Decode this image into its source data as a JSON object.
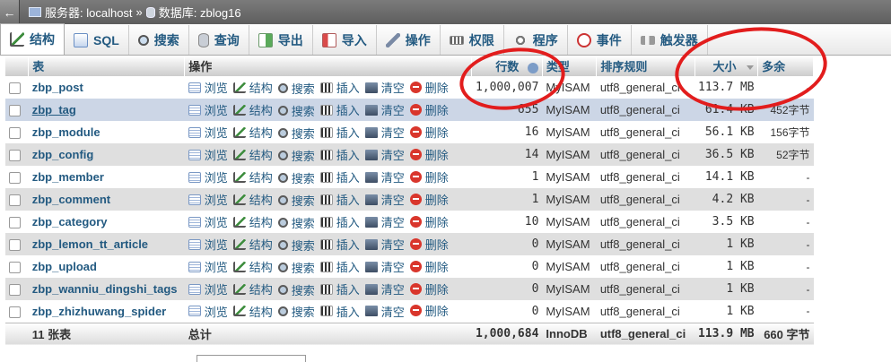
{
  "topbar": {
    "back_glyph": "←",
    "server_label": "服务器: localhost",
    "separator": "»",
    "database_label": "数据库: zblog16"
  },
  "tabs": [
    {
      "label": "结构",
      "icon": "structure-icon",
      "active": true
    },
    {
      "label": "SQL",
      "icon": "sql-icon"
    },
    {
      "label": "搜索",
      "icon": "search-icon"
    },
    {
      "label": "查询",
      "icon": "query-icon"
    },
    {
      "label": "导出",
      "icon": "export-icon"
    },
    {
      "label": "导入",
      "icon": "import-icon"
    },
    {
      "label": "操作",
      "icon": "wrench-icon"
    },
    {
      "label": "权限",
      "icon": "privileges-icon"
    },
    {
      "label": "程序",
      "icon": "routines-icon"
    },
    {
      "label": "事件",
      "icon": "clock-icon"
    },
    {
      "label": "触发器",
      "icon": "triggers-icon"
    }
  ],
  "table": {
    "headers": {
      "table": "表",
      "action": "操作",
      "rows": "行数",
      "type": "类型",
      "collation": "排序规则",
      "size": "大小",
      "overhead": "多余"
    },
    "actions": {
      "browse": "浏览",
      "structure": "结构",
      "search": "搜索",
      "insert": "插入",
      "empty": "清空",
      "drop": "删除"
    },
    "rows": [
      {
        "name": "zbp_post",
        "rows": "1,000,007",
        "type": "MyISAM",
        "collation": "utf8_general_ci",
        "size": "113.7 MB",
        "overhead": "-"
      },
      {
        "name": "zbp_tag",
        "rows": "655",
        "type": "MyISAM",
        "collation": "utf8_general_ci",
        "size": "61.4 KB",
        "overhead": "452字节"
      },
      {
        "name": "zbp_module",
        "rows": "16",
        "type": "MyISAM",
        "collation": "utf8_general_ci",
        "size": "56.1 KB",
        "overhead": "156字节"
      },
      {
        "name": "zbp_config",
        "rows": "14",
        "type": "MyISAM",
        "collation": "utf8_general_ci",
        "size": "36.5 KB",
        "overhead": "52字节"
      },
      {
        "name": "zbp_member",
        "rows": "1",
        "type": "MyISAM",
        "collation": "utf8_general_ci",
        "size": "14.1 KB",
        "overhead": "-"
      },
      {
        "name": "zbp_comment",
        "rows": "1",
        "type": "MyISAM",
        "collation": "utf8_general_ci",
        "size": "4.2 KB",
        "overhead": "-"
      },
      {
        "name": "zbp_category",
        "rows": "10",
        "type": "MyISAM",
        "collation": "utf8_general_ci",
        "size": "3.5 KB",
        "overhead": "-"
      },
      {
        "name": "zbp_lemon_tt_article",
        "rows": "0",
        "type": "MyISAM",
        "collation": "utf8_general_ci",
        "size": "1 KB",
        "overhead": "-"
      },
      {
        "name": "zbp_upload",
        "rows": "0",
        "type": "MyISAM",
        "collation": "utf8_general_ci",
        "size": "1 KB",
        "overhead": "-"
      },
      {
        "name": "zbp_wanniu_dingshi_tags",
        "rows": "0",
        "type": "MyISAM",
        "collation": "utf8_general_ci",
        "size": "1 KB",
        "overhead": "-"
      },
      {
        "name": "zbp_zhizhuwang_spider",
        "rows": "0",
        "type": "MyISAM",
        "collation": "utf8_general_ci",
        "size": "1 KB",
        "overhead": "-"
      }
    ],
    "footer": {
      "count": "11 张表",
      "total_label": "总计",
      "rows": "1,000,684",
      "type": "InnoDB",
      "collation": "utf8_general_ci",
      "size": "113.9 MB",
      "overhead": "660 字节"
    }
  },
  "colors": {
    "link": "#235a81",
    "annotation_circle": "#e21d1d"
  }
}
